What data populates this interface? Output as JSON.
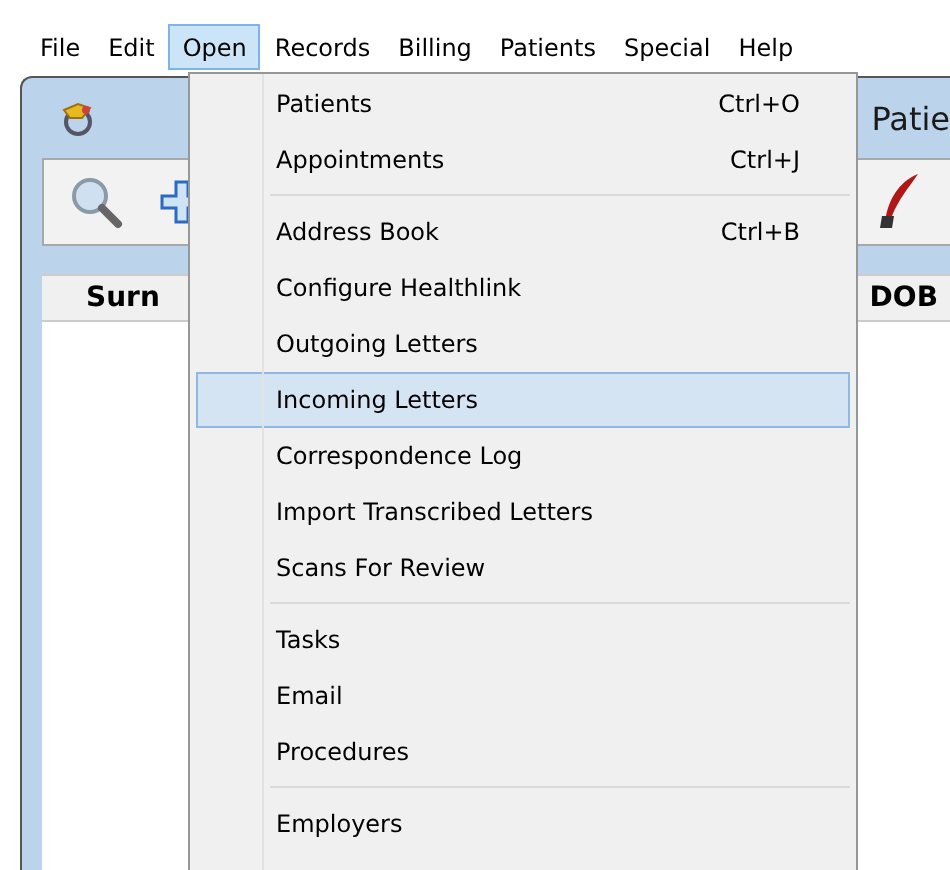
{
  "menubar": [
    {
      "label": "File",
      "selected": false
    },
    {
      "label": "Edit",
      "selected": false
    },
    {
      "label": "Open",
      "selected": true
    },
    {
      "label": "Records",
      "selected": false
    },
    {
      "label": "Billing",
      "selected": false
    },
    {
      "label": "Patients",
      "selected": false
    },
    {
      "label": "Special",
      "selected": false
    },
    {
      "label": "Help",
      "selected": false
    }
  ],
  "window": {
    "title": "Patie",
    "columns": [
      "Surn",
      "DOB"
    ]
  },
  "menu": {
    "items": [
      {
        "kind": "item",
        "label": "Patients",
        "shortcut": "Ctrl+O",
        "selected": false
      },
      {
        "kind": "item",
        "label": "Appointments",
        "shortcut": "Ctrl+J",
        "selected": false
      },
      {
        "kind": "separator"
      },
      {
        "kind": "item",
        "label": "Address Book",
        "shortcut": "Ctrl+B",
        "selected": false
      },
      {
        "kind": "item",
        "label": "Configure Healthlink",
        "selected": false
      },
      {
        "kind": "item",
        "label": "Outgoing Letters",
        "selected": false
      },
      {
        "kind": "item",
        "label": "Incoming Letters",
        "selected": true
      },
      {
        "kind": "item",
        "label": "Correspondence Log",
        "selected": false
      },
      {
        "kind": "item",
        "label": "Import Transcribed Letters",
        "selected": false
      },
      {
        "kind": "item",
        "label": "Scans For Review",
        "selected": false
      },
      {
        "kind": "separator"
      },
      {
        "kind": "item",
        "label": "Tasks",
        "selected": false
      },
      {
        "kind": "item",
        "label": "Email",
        "selected": false
      },
      {
        "kind": "item",
        "label": "Procedures",
        "selected": false
      },
      {
        "kind": "separator"
      },
      {
        "kind": "item",
        "label": "Employers",
        "selected": false
      }
    ]
  }
}
